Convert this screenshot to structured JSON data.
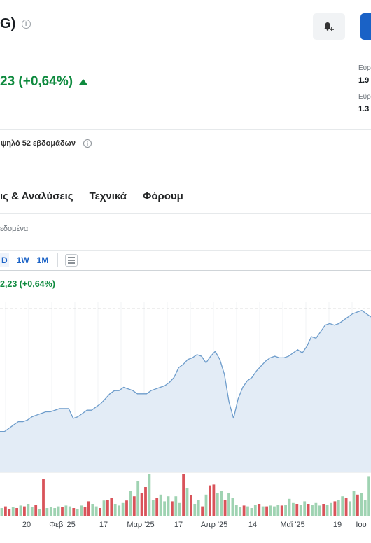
{
  "header": {
    "title": "G)",
    "price_change": "23 (+0,64%)"
  },
  "side_stats": [
    {
      "label": "Εύρ",
      "value": "1.9"
    },
    {
      "label": "Εύρ",
      "value": "1.3"
    }
  ],
  "range_row": {
    "label": "ψηλό 52 εβδομάδων"
  },
  "tabs": [
    "ις & Αναλύσεις",
    "Τεχνικά",
    "Φόρουμ"
  ],
  "data_note": "εδομένα",
  "timeframes": {
    "items": [
      "D",
      "1W",
      "1M"
    ],
    "active": "D"
  },
  "chart_header": {
    "price_change": "2,23 (+0,64%)"
  },
  "colors": {
    "up": "#0e8a3e",
    "line": "#6d9ccb",
    "area": "#e3ecf6",
    "vol_up": "#9fd3b2",
    "vol_down": "#d9535a",
    "accent": "#1a62c6"
  },
  "chart_data": {
    "type": "area",
    "x_tick_labels": [
      "20",
      "Φεβ '25",
      "17",
      "Μαρ '25",
      "17",
      "Απρ '25",
      "14",
      "Μαΐ '25",
      "19",
      "Ιου"
    ],
    "previous_close_line": 100,
    "ylim": [
      0,
      104
    ],
    "price_series": [
      25,
      25,
      27,
      29,
      31,
      31,
      32,
      34,
      35,
      36,
      37,
      37,
      38,
      39,
      39,
      39,
      33,
      34,
      36,
      38,
      38,
      40,
      42,
      45,
      48,
      50,
      50,
      52,
      51,
      50,
      48,
      48,
      48,
      50,
      51,
      52,
      53,
      55,
      58,
      64,
      66,
      69,
      70,
      72,
      71,
      67,
      71,
      74,
      69,
      60,
      43,
      33,
      45,
      52,
      56,
      58,
      62,
      65,
      68,
      70,
      71,
      70,
      70,
      71,
      73,
      75,
      73,
      77,
      83,
      82,
      86,
      90,
      91,
      90,
      91,
      93,
      95,
      97,
      98,
      99,
      97,
      95
    ],
    "volume_series": [
      {
        "v": 10,
        "dir": "up"
      },
      {
        "v": 12,
        "dir": "down"
      },
      {
        "v": 9,
        "dir": "down"
      },
      {
        "v": 11,
        "dir": "up"
      },
      {
        "v": 10,
        "dir": "down"
      },
      {
        "v": 13,
        "dir": "up"
      },
      {
        "v": 12,
        "dir": "down"
      },
      {
        "v": 15,
        "dir": "up"
      },
      {
        "v": 11,
        "dir": "up"
      },
      {
        "v": 14,
        "dir": "down"
      },
      {
        "v": 9,
        "dir": "up"
      },
      {
        "v": 45,
        "dir": "down"
      },
      {
        "v": 10,
        "dir": "up"
      },
      {
        "v": 11,
        "dir": "up"
      },
      {
        "v": 10,
        "dir": "up"
      },
      {
        "v": 12,
        "dir": "up"
      },
      {
        "v": 11,
        "dir": "down"
      },
      {
        "v": 13,
        "dir": "up"
      },
      {
        "v": 12,
        "dir": "up"
      },
      {
        "v": 10,
        "dir": "down"
      },
      {
        "v": 9,
        "dir": "up"
      },
      {
        "v": 13,
        "dir": "up"
      },
      {
        "v": 11,
        "dir": "down"
      },
      {
        "v": 18,
        "dir": "down"
      },
      {
        "v": 15,
        "dir": "up"
      },
      {
        "v": 12,
        "dir": "up"
      },
      {
        "v": 10,
        "dir": "down"
      },
      {
        "v": 19,
        "dir": "up"
      },
      {
        "v": 20,
        "dir": "down"
      },
      {
        "v": 22,
        "dir": "down"
      },
      {
        "v": 15,
        "dir": "up"
      },
      {
        "v": 13,
        "dir": "up"
      },
      {
        "v": 16,
        "dir": "up"
      },
      {
        "v": 19,
        "dir": "down"
      },
      {
        "v": 30,
        "dir": "up"
      },
      {
        "v": 24,
        "dir": "down"
      },
      {
        "v": 42,
        "dir": "up"
      },
      {
        "v": 28,
        "dir": "down"
      },
      {
        "v": 35,
        "dir": "down"
      },
      {
        "v": 50,
        "dir": "up"
      },
      {
        "v": 20,
        "dir": "up"
      },
      {
        "v": 22,
        "dir": "down"
      },
      {
        "v": 26,
        "dir": "up"
      },
      {
        "v": 18,
        "dir": "up"
      },
      {
        "v": 24,
        "dir": "up"
      },
      {
        "v": 18,
        "dir": "down"
      },
      {
        "v": 24,
        "dir": "up"
      },
      {
        "v": 16,
        "dir": "up"
      },
      {
        "v": 50,
        "dir": "down"
      },
      {
        "v": 34,
        "dir": "up"
      },
      {
        "v": 25,
        "dir": "down"
      },
      {
        "v": 15,
        "dir": "up"
      },
      {
        "v": 20,
        "dir": "up"
      },
      {
        "v": 12,
        "dir": "down"
      },
      {
        "v": 26,
        "dir": "up"
      },
      {
        "v": 37,
        "dir": "down"
      },
      {
        "v": 38,
        "dir": "down"
      },
      {
        "v": 28,
        "dir": "up"
      },
      {
        "v": 30,
        "dir": "up"
      },
      {
        "v": 20,
        "dir": "down"
      },
      {
        "v": 28,
        "dir": "up"
      },
      {
        "v": 22,
        "dir": "up"
      },
      {
        "v": 14,
        "dir": "up"
      },
      {
        "v": 11,
        "dir": "up"
      },
      {
        "v": 13,
        "dir": "down"
      },
      {
        "v": 12,
        "dir": "up"
      },
      {
        "v": 10,
        "dir": "up"
      },
      {
        "v": 14,
        "dir": "up"
      },
      {
        "v": 15,
        "dir": "down"
      },
      {
        "v": 12,
        "dir": "up"
      },
      {
        "v": 12,
        "dir": "down"
      },
      {
        "v": 13,
        "dir": "up"
      },
      {
        "v": 12,
        "dir": "up"
      },
      {
        "v": 14,
        "dir": "up"
      },
      {
        "v": 13,
        "dir": "down"
      },
      {
        "v": 14,
        "dir": "up"
      },
      {
        "v": 21,
        "dir": "up"
      },
      {
        "v": 16,
        "dir": "up"
      },
      {
        "v": 15,
        "dir": "down"
      },
      {
        "v": 14,
        "dir": "up"
      },
      {
        "v": 18,
        "dir": "up"
      },
      {
        "v": 15,
        "dir": "down"
      },
      {
        "v": 14,
        "dir": "up"
      },
      {
        "v": 16,
        "dir": "up"
      },
      {
        "v": 13,
        "dir": "up"
      },
      {
        "v": 15,
        "dir": "down"
      },
      {
        "v": 14,
        "dir": "up"
      },
      {
        "v": 16,
        "dir": "up"
      },
      {
        "v": 18,
        "dir": "down"
      },
      {
        "v": 20,
        "dir": "up"
      },
      {
        "v": 24,
        "dir": "up"
      },
      {
        "v": 22,
        "dir": "down"
      },
      {
        "v": 18,
        "dir": "up"
      },
      {
        "v": 30,
        "dir": "up"
      },
      {
        "v": 26,
        "dir": "down"
      },
      {
        "v": 28,
        "dir": "up"
      },
      {
        "v": 20,
        "dir": "up"
      },
      {
        "v": 48,
        "dir": "up"
      }
    ]
  }
}
